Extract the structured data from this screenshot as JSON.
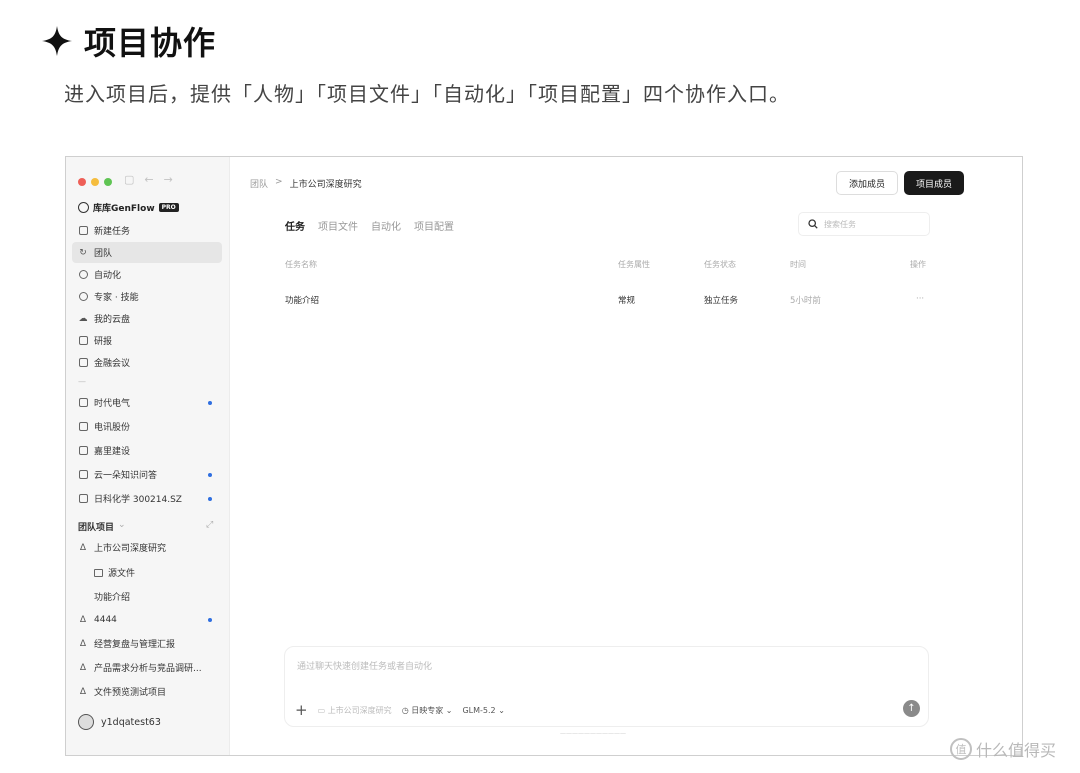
{
  "heading": {
    "title": "项目协作",
    "icon": "sparkle-icon"
  },
  "subtitle": "进入项目后，提供「人物」「项目文件」「自动化」「项目配置」四个协作入口。",
  "window": {
    "traffic_colors": [
      "#ee5f57",
      "#f5bd3e",
      "#5fc453"
    ],
    "brand": {
      "name": "库库GenFlow",
      "badge": "PRO"
    },
    "sidebar": {
      "items": [
        {
          "label": "新建任务",
          "icon": "new-task-icon"
        },
        {
          "label": "团队",
          "icon": "team-icon",
          "active": true
        },
        {
          "label": "自动化",
          "icon": "clock-icon"
        },
        {
          "label": "专家 · 技能",
          "icon": "expert-icon"
        },
        {
          "label": "我的云盘",
          "icon": "cloud-icon"
        },
        {
          "label": "研报",
          "icon": "report-icon"
        },
        {
          "label": "金融会议",
          "icon": "meeting-icon"
        }
      ],
      "files": [
        {
          "label": "时代电气",
          "dot": true
        },
        {
          "label": "电讯股份",
          "dot": false
        },
        {
          "label": "嘉里建设",
          "dot": false
        },
        {
          "label": "云一朵知识问答",
          "dot": true
        },
        {
          "label": "日科化学 300214.SZ",
          "dot": true
        }
      ],
      "section_label": "团队项目",
      "projects": [
        {
          "label": "上市公司深度研究"
        },
        {
          "label": "源文件",
          "sub": true
        },
        {
          "label": "功能介绍",
          "sub": true
        },
        {
          "label": "4444",
          "dot": true
        },
        {
          "label": "经营复盘与管理汇报"
        },
        {
          "label": "产品需求分析与竞品调研..."
        },
        {
          "label": "文件预览测试项目"
        }
      ],
      "user": "y1dqatest63"
    },
    "breadcrumb": {
      "root": "团队",
      "sep": ">",
      "current": "上市公司深度研究"
    },
    "buttons": {
      "add_member": "添加成员",
      "project_member": "项目成员"
    },
    "tabs": [
      "任务",
      "项目文件",
      "自动化",
      "项目配置"
    ],
    "search_placeholder": "搜索任务",
    "table": {
      "headers": [
        "任务名称",
        "任务属性",
        "任务状态",
        "时间",
        "操作"
      ],
      "rows": [
        {
          "name": "功能介绍",
          "attr": "常规",
          "status": "独立任务",
          "time": "5小时前",
          "action": "···"
        }
      ]
    },
    "composer": {
      "placeholder": "通过聊天快速创建任务或者自动化",
      "context": "上市公司深度研究",
      "expert": "日映专家",
      "model": "GLM-5.2"
    }
  },
  "watermark": "什么值得买"
}
